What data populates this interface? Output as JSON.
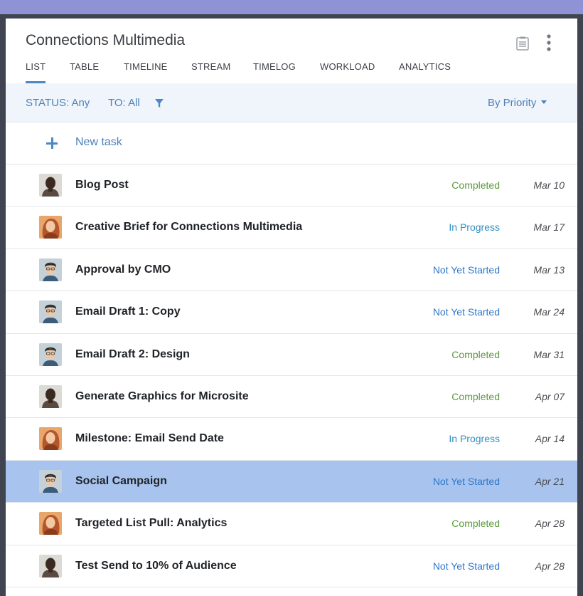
{
  "header": {
    "title": "Connections Multimedia",
    "icons": [
      "clipboard-icon",
      "more-vertical-icon"
    ]
  },
  "tabs": [
    {
      "label": "LIST",
      "active": true
    },
    {
      "label": "TABLE"
    },
    {
      "label": "TIMELINE"
    },
    {
      "label": "STREAM"
    },
    {
      "label": "TIMELOG"
    },
    {
      "label": "WORKLOAD"
    },
    {
      "label": "ANALYTICS"
    }
  ],
  "filters": {
    "status": "STATUS: Any",
    "to": "TO: All",
    "sort": "By Priority",
    "filter_icon": "funnel-icon"
  },
  "new_task": {
    "label": "New task",
    "icon": "plus-icon"
  },
  "colors": {
    "accent": "#4b87c5",
    "completed": "#5a9a3a",
    "in_progress": "#2f8fc0",
    "not_started": "#2f77c7",
    "selected_row": "#a8c4ee",
    "top_band": "#8f93d6"
  },
  "tasks": [
    {
      "name": "Blog Post",
      "status": "Completed",
      "date": "Mar 10",
      "avatar": "a"
    },
    {
      "name": "Creative Brief for Connections Multimedia",
      "status": "In Progress",
      "date": "Mar 17",
      "avatar": "b"
    },
    {
      "name": "Approval by CMO",
      "status": "Not Yet Started",
      "date": "Mar 13",
      "avatar": "c"
    },
    {
      "name": "Email Draft 1: Copy",
      "status": "Not Yet Started",
      "date": "Mar 24",
      "avatar": "c"
    },
    {
      "name": "Email Draft 2: Design",
      "status": "Completed",
      "date": "Mar 31",
      "avatar": "c"
    },
    {
      "name": "Generate Graphics for Microsite",
      "status": "Completed",
      "date": "Apr 07",
      "avatar": "a"
    },
    {
      "name": "Milestone: Email Send Date",
      "status": "In Progress",
      "date": "Apr 14",
      "avatar": "b"
    },
    {
      "name": "Social Campaign",
      "status": "Not Yet Started",
      "date": "Apr 21",
      "avatar": "c",
      "selected": true
    },
    {
      "name": "Targeted List Pull: Analytics",
      "status": "Completed",
      "date": "Apr 28",
      "avatar": "b"
    },
    {
      "name": "Test Send to 10% of Audience",
      "status": "Not Yet Started",
      "date": "Apr 28",
      "avatar": "a"
    }
  ]
}
